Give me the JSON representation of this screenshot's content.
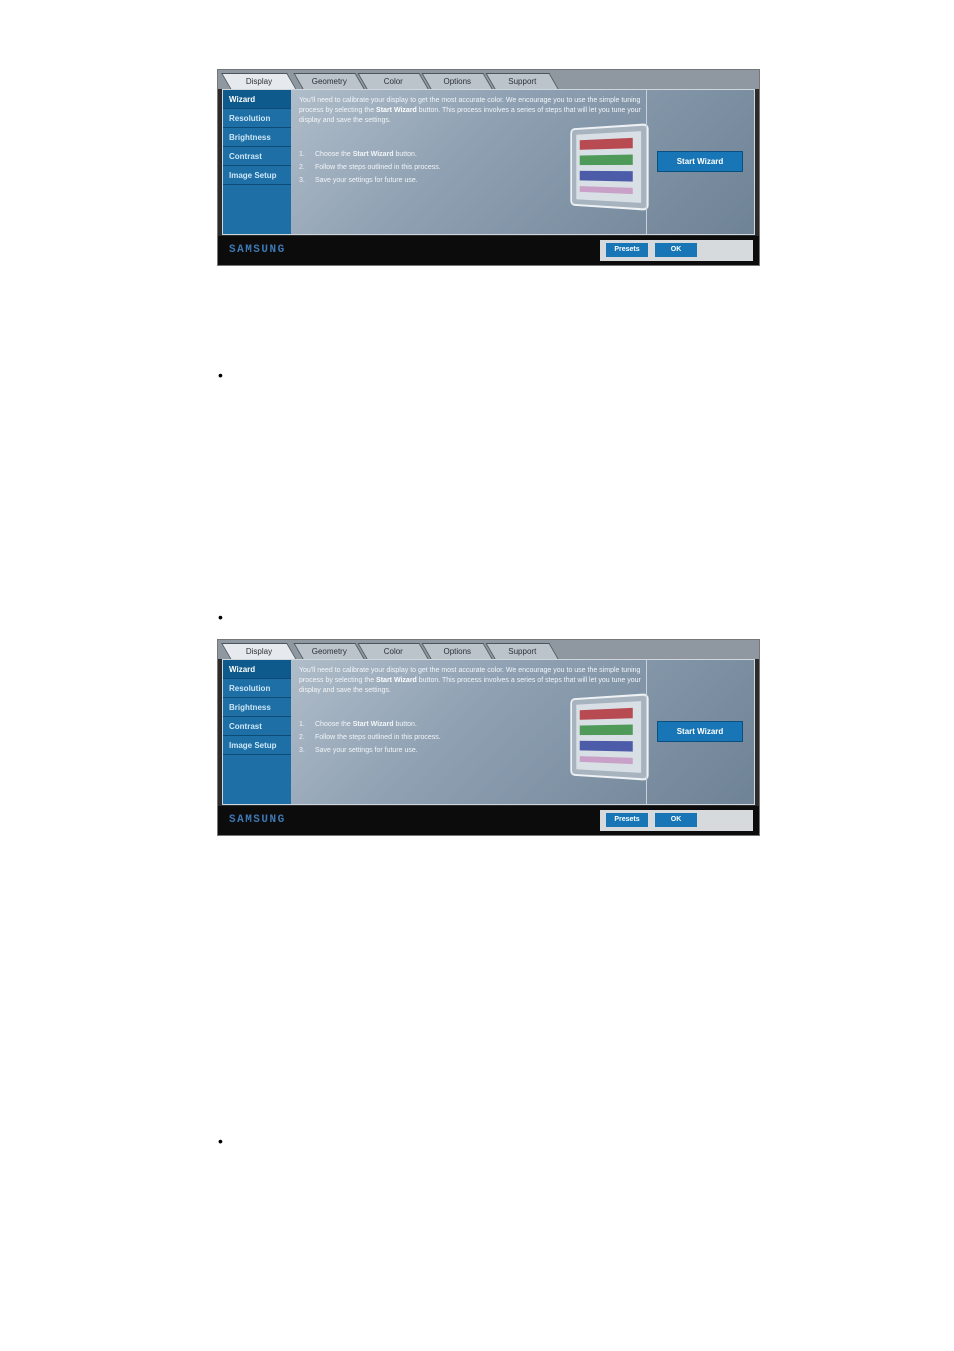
{
  "tabs": [
    "Display",
    "Geometry",
    "Color",
    "Options",
    "Support"
  ],
  "sidebar_items": [
    "Wizard",
    "Resolution",
    "Brightness",
    "Contrast",
    "Image Setup"
  ],
  "description": {
    "part1": "You'll need to calibrate your display to get the most accurate color. We encourage you to use the simple tuning process by selecting the ",
    "emph": "Start Wizard",
    "part2": " button. This process involves a series of steps that will let you tune your display and save the settings."
  },
  "steps": [
    {
      "num": "1.",
      "pre": "Choose the ",
      "emph": "Start Wizard",
      "post": " button."
    },
    {
      "num": "2.",
      "pre": "Follow the steps outlined in this process.",
      "emph": "",
      "post": ""
    },
    {
      "num": "3.",
      "pre": "Save your settings for future use.",
      "emph": "",
      "post": ""
    }
  ],
  "start_wizard_label": "Start Wizard",
  "logo_text": "SAMSUNG",
  "presets_label": "Presets",
  "ok_label": "OK",
  "bullet_char": "•",
  "colors": {
    "accent_blue": "#1876b6",
    "sidebar_blue": "#1d6fa6",
    "footer_black": "#0c0c0c",
    "logo_blue": "#3d78b4"
  }
}
